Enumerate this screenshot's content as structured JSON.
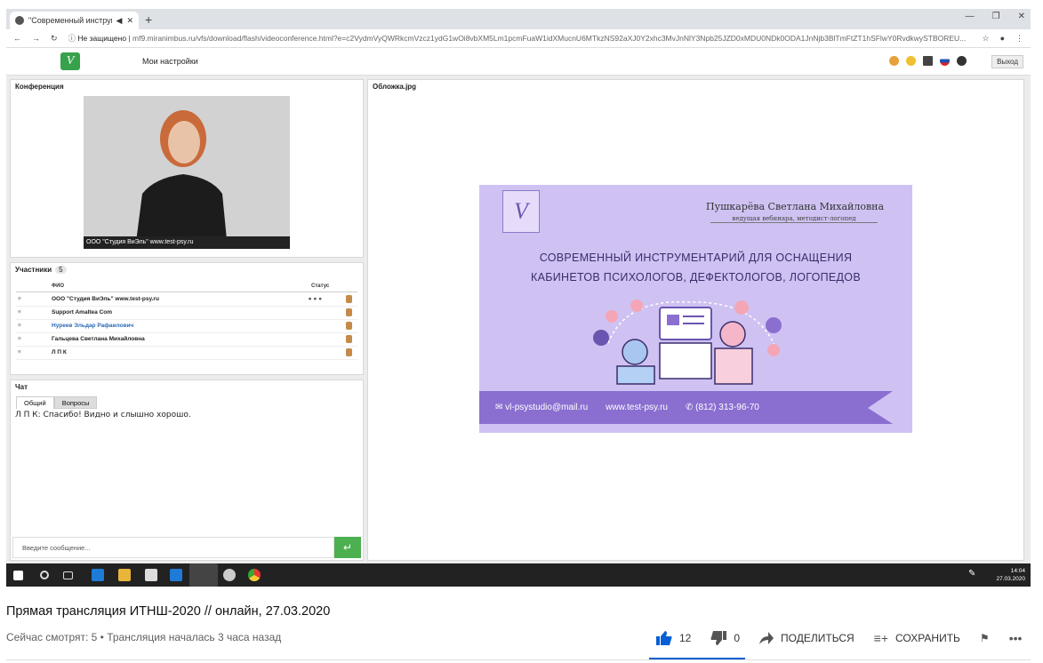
{
  "browser": {
    "tab_title": "\"Современный инструме",
    "url_prefix": "Не защищено",
    "url": "mf9.miranimbus.ru/vfs/download/flash/videoconference.html?e=c2VydmVyQWRkcmVzcz1ydG1wOi8vbXM5Lm1pcmFuaW1idXMucnU6MTkzNS92aXJ0Y2xhc3MvJnNlY3Npb25JZD0xMDU0NDk0ODA1JnNjb3BlTmFtZT1hSFlwY0RvdkwySTBOREU..."
  },
  "app": {
    "settings_label": "Мои настройки",
    "exit_label": "Выход"
  },
  "conference": {
    "header": "Конференция",
    "caption": "ООО \"Студия ВиЭль\" www.test-psy.ru"
  },
  "participants": {
    "header": "Участники",
    "count": "5",
    "col_name": "ФИО",
    "col_status": "Статус",
    "rows": [
      {
        "name": "ООО \"Студия ВиЭль\" www.test-psy.ru"
      },
      {
        "name": "Support Amaltea Com"
      },
      {
        "name": "Нуреев Эльдар Рафаилович"
      },
      {
        "name": "Гальцева Светлана Михайловна"
      },
      {
        "name": "Л П К"
      }
    ]
  },
  "chat": {
    "header": "Чат",
    "tab_general": "Общий",
    "tab_questions": "Вопросы",
    "message": "Л П К: Спасибо! Видно и слышно хорошо.",
    "input_placeholder": "Введите сообщение..."
  },
  "cover": {
    "header": "Обложка.jpg",
    "name": "Пушкарёва Светлана Михайловна",
    "subtitle": "ведущая вебинара, методист-логопед",
    "title_line1": "СОВРЕМЕННЫЙ ИНСТРУМЕНТАРИЙ ДЛЯ ОСНАЩЕНИЯ",
    "title_line2": "КАБИНЕТОВ ПСИХОЛОГОВ, ДЕФЕКТОЛОГОВ, ЛОГОПЕДОВ",
    "email": "vl-psystudio@mail.ru",
    "site": "www.test-psy.ru",
    "phone": "(812) 313-96-70"
  },
  "taskbar": {
    "time": "14:04",
    "date": "27.03.2020"
  },
  "youtube": {
    "title": "Прямая трансляция ИТНШ-2020 // онлайн, 27.03.2020",
    "meta": "Сейчас смотрят: 5 • Трансляция началась 3 часа назад",
    "likes": "12",
    "dislikes": "0",
    "share": "ПОДЕЛИТЬСЯ",
    "save": "СОХРАНИТЬ"
  },
  "colors": {
    "slide_bg": "#cfc2f3",
    "slide_footer": "#8a6fd0",
    "send_button": "#4caf50",
    "link_blue": "#065fd4"
  }
}
